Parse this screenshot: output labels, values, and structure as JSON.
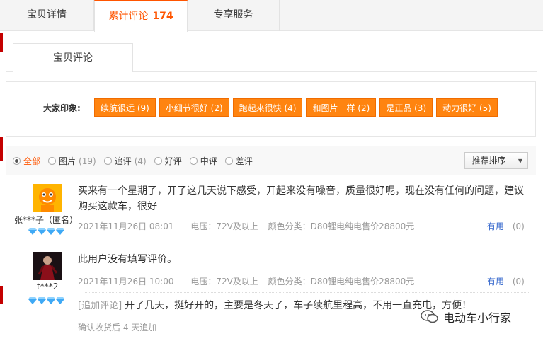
{
  "tabs": [
    {
      "label": "宝贝详情"
    },
    {
      "label": "累计评论",
      "count": "174"
    },
    {
      "label": "专享服务"
    }
  ],
  "subtab": {
    "label": "宝贝评论"
  },
  "impressions": {
    "label": "大家印象:",
    "tags": [
      "续航很远 (9)",
      "小细节很好 (2)",
      "跑起来很快 (4)",
      "和图片一样 (2)",
      "是正品 (3)",
      "动力很好 (5)"
    ]
  },
  "filter": {
    "options": [
      {
        "label": "全部",
        "count": ""
      },
      {
        "label": "图片",
        "count": "(19)"
      },
      {
        "label": "追评",
        "count": "(4)"
      },
      {
        "label": "好评",
        "count": ""
      },
      {
        "label": "中评",
        "count": ""
      },
      {
        "label": "差评",
        "count": ""
      }
    ],
    "sort_label": "推荐排序"
  },
  "reviews": [
    {
      "user": "张***子（匿名）",
      "text": "买来有一个星期了，开了这几天说下感受，开起来没有噪音，质量很好呢，现在没有任何的问题，建议购买这款车，很好",
      "date": "2021年11月26日 08:01",
      "voltage": "电压：72V及以上",
      "color": "颜色分类：D80锂电纯电售价28800元",
      "useful_label": "有用",
      "useful_count": "(0)"
    },
    {
      "user": "t***2",
      "text": "此用户没有填写评价。",
      "date": "2021年11月26日 10:00",
      "voltage": "电压：72V及以上",
      "color": "颜色分类：D80锂电纯电售价28800元",
      "useful_label": "有用",
      "useful_count": "(0)",
      "append_tag": "[追加评论]",
      "append_text": "开了几天，挺好开的，主要是冬天了，车子续航里程高，不用一直充电，方便！",
      "append_note": "确认收货后 4 天追加"
    }
  ],
  "watermark": "电动车小行家",
  "colors": {
    "accent": "#ff5500",
    "tag_bg": "#ff8410",
    "mark": "#c40000",
    "link": "#3366cc"
  }
}
